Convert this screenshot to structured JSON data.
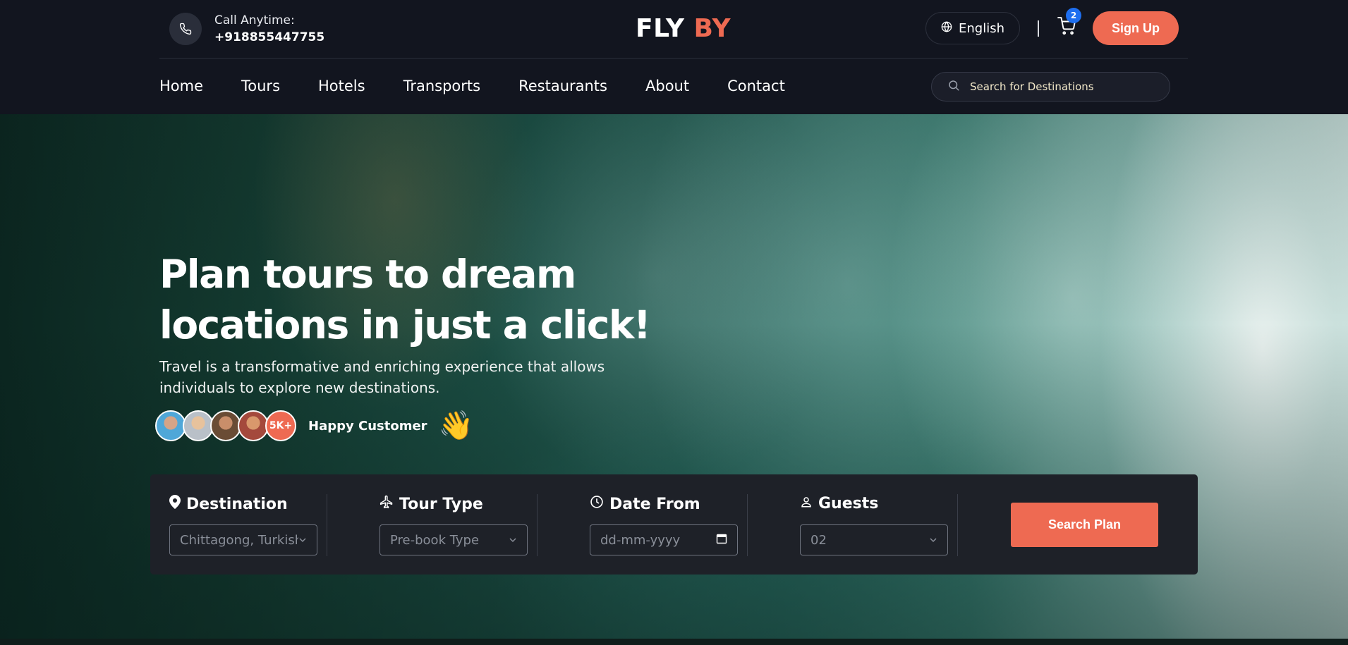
{
  "header": {
    "call_label": "Call Anytime:",
    "call_number": "+918855447755",
    "logo_part1": "FLY",
    "logo_part2": "BY",
    "language": "English",
    "cart_count": "2",
    "signup_label": "Sign Up",
    "nav": [
      "Home",
      "Tours",
      "Hotels",
      "Transports",
      "Restaurants",
      "About",
      "Contact"
    ],
    "search_placeholder": "Search for Destinations"
  },
  "hero": {
    "title_line1": "Plan tours to dream",
    "title_line2": "locations in just a click!",
    "description": "Travel is a transformative and enriching experience that allows individuals to explore new destinations.",
    "customer_count": "5K+",
    "happy_label": "Happy Customer",
    "wave_emoji": "👋"
  },
  "booking": {
    "destination": {
      "title": "Destination",
      "value": "Chittagong, Turkish",
      "icon": "location-pin-icon"
    },
    "tour_type": {
      "title": "Tour Type",
      "value": "Pre-book Type",
      "icon": "airplane-icon"
    },
    "date_from": {
      "title": "Date From",
      "value": "dd-mm-yyyy",
      "icon": "clock-icon"
    },
    "guests": {
      "title": "Guests",
      "value": "02",
      "icon": "person-icon"
    },
    "search_label": "Search Plan"
  },
  "colors": {
    "accent": "#ee6a52",
    "header_bg": "#12151f",
    "badge": "#1e6ff0",
    "panel_bg": "#1e2128"
  }
}
